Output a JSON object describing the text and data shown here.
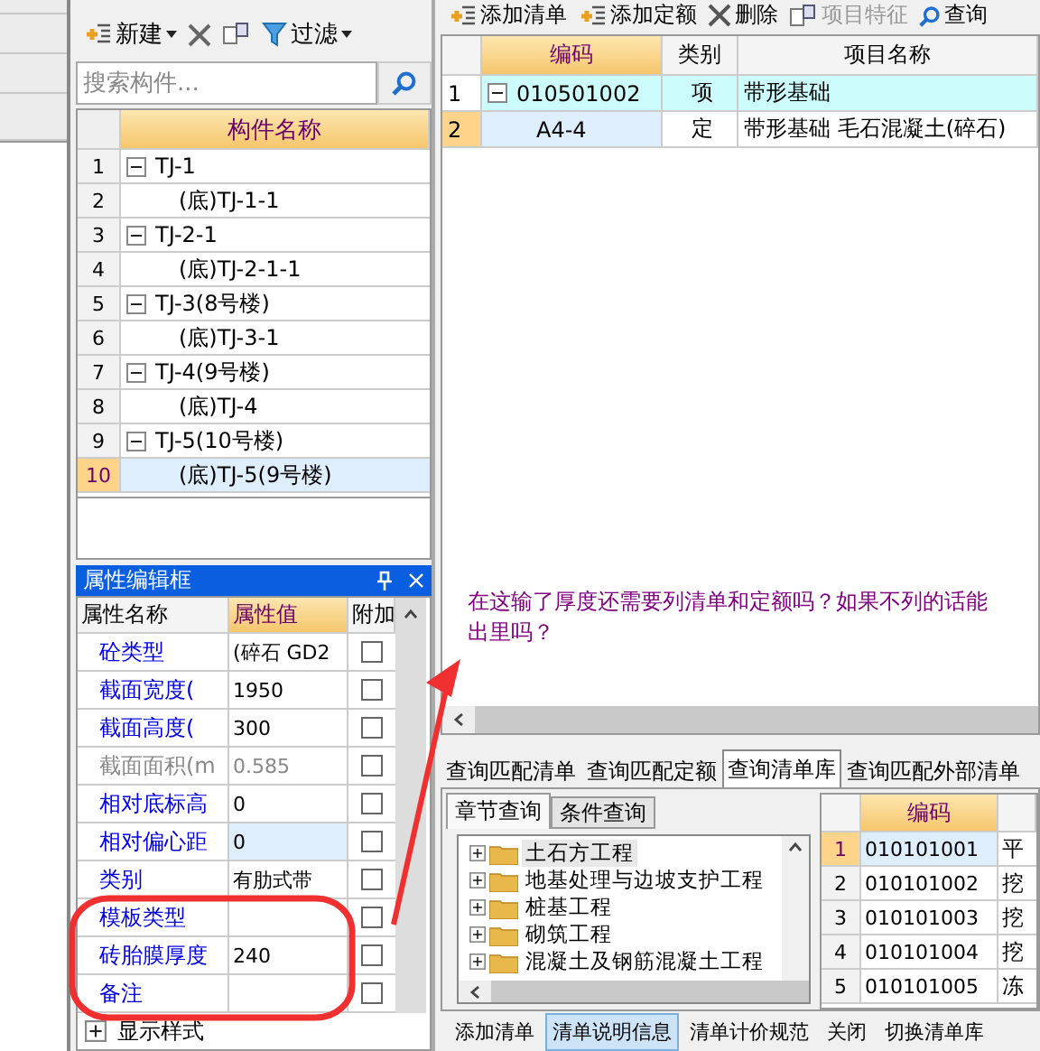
{
  "component_list": {
    "toolbar": [
      {
        "kind": "new",
        "label": "新建"
      },
      {
        "kind": "delete"
      },
      {
        "kind": "copy"
      },
      {
        "kind": "filter",
        "label": "过滤"
      }
    ],
    "search": {
      "placeholder": "搜索构件..."
    },
    "column": "构件名称",
    "rows": [
      {
        "number": "1",
        "name": "TJ-1",
        "expanded": true,
        "selected": false,
        "children": [
          {
            "number": "2",
            "name": "(底)TJ-1-1",
            "selected": false
          }
        ]
      },
      {
        "number": "3",
        "name": "TJ-2-1",
        "expanded": true,
        "selected": false,
        "children": [
          {
            "number": "4",
            "name": "(底)TJ-2-1-1",
            "selected": false
          }
        ]
      },
      {
        "number": "5",
        "name": "TJ-3(8号楼)",
        "expanded": true,
        "selected": false,
        "children": [
          {
            "number": "6",
            "name": "(底)TJ-3-1",
            "selected": false
          }
        ]
      },
      {
        "number": "7",
        "name": "TJ-4(9号楼)",
        "expanded": true,
        "selected": false,
        "children": [
          {
            "number": "8",
            "name": "(底)TJ-4",
            "selected": false
          }
        ]
      },
      {
        "number": "9",
        "name": "TJ-5(10号楼)",
        "expanded": true,
        "selected": false,
        "children": [
          {
            "number": "10",
            "name": "(底)TJ-5(9号楼)",
            "selected": true
          }
        ]
      }
    ]
  },
  "property_panel": {
    "title": "属性编辑框",
    "columns": [
      "属性名称",
      "属性值",
      "附加"
    ],
    "rows": [
      {
        "name": "砼类型",
        "value": "(碎石 GD2",
        "checked": false,
        "disabled": false,
        "selected": false
      },
      {
        "name": "截面宽度(",
        "value": "1950",
        "checked": false,
        "disabled": false,
        "selected": false
      },
      {
        "name": "截面高度(",
        "value": "300",
        "checked": false,
        "disabled": false,
        "selected": false
      },
      {
        "name": "截面面积(m",
        "value": "0.585",
        "checked": false,
        "disabled": true,
        "selected": false
      },
      {
        "name": "相对底标高",
        "value": "0",
        "checked": false,
        "disabled": false,
        "selected": false
      },
      {
        "name": "相对偏心距",
        "value": "0",
        "checked": false,
        "disabled": false,
        "selected": true
      },
      {
        "name": "类别",
        "value": "有肋式带",
        "checked": false,
        "disabled": false,
        "selected": false
      },
      {
        "name": "模板类型",
        "checked": false,
        "disabled": false,
        "selected": false
      },
      {
        "name": "砖胎膜厚度",
        "value": "240",
        "checked": false,
        "disabled": false,
        "selected": false
      },
      {
        "name": "备注",
        "checked": false,
        "disabled": false,
        "selected": false
      }
    ],
    "footer": {
      "label": "显示样式",
      "expanded": false
    }
  },
  "bill_toolbar": [
    {
      "kind": "add",
      "label": "添加清单",
      "disabled": false
    },
    {
      "kind": "add",
      "label": "添加定额",
      "disabled": false
    },
    {
      "kind": "delete",
      "label": "删除",
      "disabled": false
    },
    {
      "kind": "feature",
      "label": "项目特征",
      "disabled": true
    },
    {
      "kind": "search",
      "label": "查询",
      "disabled": false
    }
  ],
  "bill_table": {
    "columns": [
      "编码",
      "类别",
      "项目名称"
    ],
    "rows": [
      {
        "number": "1",
        "code": "010501002",
        "type": "项",
        "name": "带形基础",
        "kind": "item",
        "expanded": true,
        "selected": false,
        "children": [
          {
            "number": "2",
            "code": "A4-4",
            "type": "定",
            "name": "带形基础 毛石混凝土(碎石)",
            "kind": "quota",
            "selected": true
          }
        ]
      }
    ]
  },
  "question": "在这输了厚度还需要列清单和定额吗？如果不列的话能出里吗？",
  "query_tabs": [
    {
      "label": "查询匹配清单",
      "selected": false
    },
    {
      "label": "查询匹配定额",
      "selected": false
    },
    {
      "label": "查询清单库",
      "selected": true
    },
    {
      "label": "查询匹配外部清单",
      "selected": false
    }
  ],
  "sub_tabs": [
    {
      "label": "章节查询",
      "selected": true
    },
    {
      "label": "条件查询",
      "selected": false
    }
  ],
  "chapter_tree": [
    {
      "label": "土石方工程",
      "selected": true
    },
    {
      "label": "地基处理与边坡支护工程",
      "selected": false
    },
    {
      "label": "桩基工程",
      "selected": false
    },
    {
      "label": "砌筑工程",
      "selected": false
    },
    {
      "label": "混凝土及钢筋混凝土工程",
      "selected": false
    }
  ],
  "library_table": {
    "columns": [
      "编码"
    ],
    "rows": [
      {
        "number": "1",
        "code": "010101001",
        "name": "平",
        "selected": true
      },
      {
        "number": "2",
        "code": "010101002",
        "name": "挖",
        "selected": false
      },
      {
        "number": "3",
        "code": "010101003",
        "name": "挖",
        "selected": false
      },
      {
        "number": "4",
        "code": "010101004",
        "name": "挖",
        "selected": false
      },
      {
        "number": "5",
        "code": "010101005",
        "name": "冻",
        "selected": false
      }
    ]
  },
  "bottom_buttons": [
    {
      "label": "添加清单",
      "selected": false
    },
    {
      "label": "清单说明信息",
      "selected": true
    },
    {
      "label": "清单计价规范",
      "selected": false
    },
    {
      "label": "关闭",
      "selected": false
    },
    {
      "label": "切换清单库",
      "selected": false
    }
  ]
}
